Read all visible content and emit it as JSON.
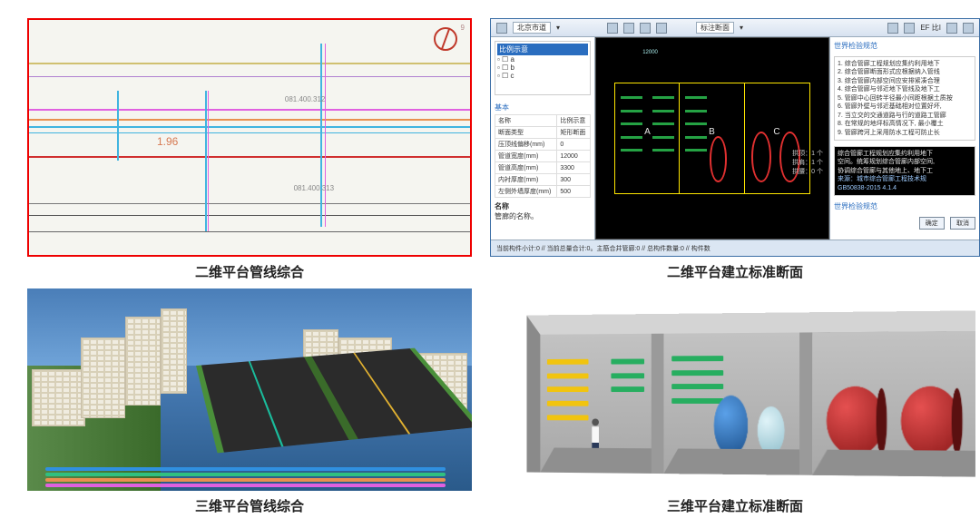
{
  "captions": {
    "p1": "二维平台管线综合",
    "p2": "二维平台建立标准断面",
    "p3": "三维平台管线综合",
    "p4": "三维平台建立标准断面"
  },
  "panel1": {
    "grade_label": "1.96",
    "compass_label": "9"
  },
  "panel2": {
    "toolbar": {
      "dropdown_a": "北京市道",
      "dropdown_b": "标注断面"
    },
    "tree": {
      "root": "比例示意",
      "items": [
        "a",
        "b",
        "c"
      ]
    },
    "properties": {
      "group_title": "基本",
      "rows": [
        {
          "k": "名称",
          "v": "比例示意"
        },
        {
          "k": "断面类型",
          "v": "矩形断面"
        },
        {
          "k": "压顶线偏移(mm)",
          "v": "0"
        },
        {
          "k": "管道宽度(mm)",
          "v": "12000"
        },
        {
          "k": "管道高度(mm)",
          "v": "3300"
        },
        {
          "k": "内衬厚度(mm)",
          "v": "300"
        },
        {
          "k": "左侧外墙厚度(mm)",
          "v": "500"
        }
      ],
      "name_label": "名称",
      "name_hint": "管廊的名称。"
    },
    "section_labels": {
      "a": "A",
      "b": "B",
      "c": "C"
    },
    "counts": {
      "line1": "拱顶：1 个",
      "line2": "拱肩：1 个",
      "line3": "拱腰：0 个"
    },
    "right_notes_title": "世界检验规范",
    "right_notes": [
      "综合管廊工程规划应集约利用地下",
      "综合管廊断面形式应根据纳入管线",
      "综合管廊内部空间应安排紧凑合理",
      "综合管廊与邻近地下管线及地下工",
      "管廊中心回转半径最小间距根据土质按",
      "管廊外壁与邻近基础相对位置好坏,",
      "当立交的交通道路与行的道路工管廊",
      "在常规的地坪标高情况下, 最小覆土",
      "管廊跨河上采用防水工程可防止长"
    ],
    "right_box_dark": [
      "综合管廊工程规划应集约利用地下",
      "空间。统筹规划综合管廊内部空间,",
      "协调综合管廊与其他地上、地下工",
      "来源：城市综合管廊工程技术规",
      "GB50838-2015 4.1.4"
    ],
    "status_left": "当前构件小计:0 // 当前总量合计:0。主筋合并管廊:0 // 总构件数量:0 // 构件数",
    "buttons": {
      "ok": "确定",
      "cancel": "取消"
    }
  }
}
